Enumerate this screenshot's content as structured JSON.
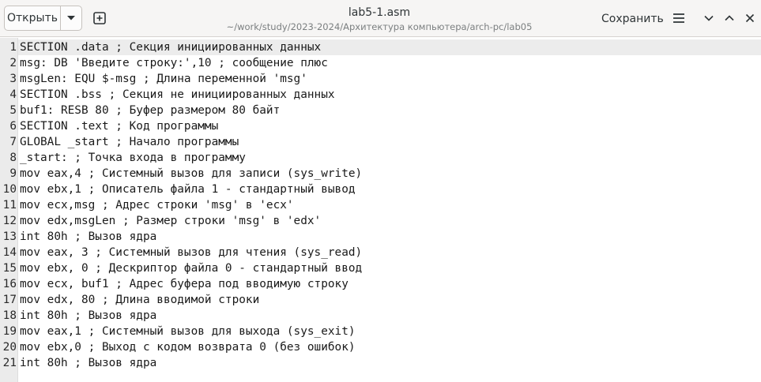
{
  "header": {
    "open_label": "Открыть",
    "title": "lab5-1.asm",
    "path": "~/work/study/2023-2024/Архитектура компьютера/arch-pc/lab05",
    "save_label": "Сохранить"
  },
  "icons": {
    "open_menu": "chevron-down-icon",
    "new_tab": "new-tab-icon",
    "main_menu": "hamburger-menu-icon",
    "minimize": "minimize-icon",
    "maximize": "maximize-icon",
    "close": "close-icon"
  },
  "editor": {
    "current_line": 1,
    "lines": [
      {
        "n": "1",
        "text": "SECTION .data ; Секция инициированных данных"
      },
      {
        "n": "2",
        "text": "msg: DB 'Введите строку:',10 ; сообщение плюс"
      },
      {
        "n": "3",
        "text": "msgLen: EQU $-msg ; Длина переменной 'msg'"
      },
      {
        "n": "4",
        "text": "SECTION .bss ; Секция не инициированных данных"
      },
      {
        "n": "5",
        "text": "buf1: RESB 80 ; Буфер размером 80 байт"
      },
      {
        "n": "6",
        "text": "SECTION .text ; Код программы"
      },
      {
        "n": "7",
        "text": "GLOBAL _start ; Начало программы"
      },
      {
        "n": "8",
        "text": "_start: ; Точка входа в программу"
      },
      {
        "n": "9",
        "text": "mov eax,4 ; Системный вызов для записи (sys_write)"
      },
      {
        "n": "10",
        "text": "mov ebx,1 ; Описатель файла 1 - стандартный вывод"
      },
      {
        "n": "11",
        "text": "mov ecx,msg ; Адрес строки 'msg' в 'ecx'"
      },
      {
        "n": "12",
        "text": "mov edx,msgLen ; Размер строки 'msg' в 'edx'"
      },
      {
        "n": "13",
        "text": "int 80h ; Вызов ядра"
      },
      {
        "n": "14",
        "text": "mov eax, 3 ; Системный вызов для чтения (sys_read)"
      },
      {
        "n": "15",
        "text": "mov ebx, 0 ; Дескриптор файла 0 - стандартный ввод"
      },
      {
        "n": "16",
        "text": "mov ecx, buf1 ; Адрес буфера под вводимую строку"
      },
      {
        "n": "17",
        "text": "mov edx, 80 ; Длина вводимой строки"
      },
      {
        "n": "18",
        "text": "int 80h ; Вызов ядра"
      },
      {
        "n": "19",
        "text": "mov eax,1 ; Системный вызов для выхода (sys_exit)"
      },
      {
        "n": "20",
        "text": "mov ebx,0 ; Выход с кодом возврата 0 (без ошибок)"
      },
      {
        "n": "21",
        "text": "int 80h ; Вызов ядра"
      }
    ]
  }
}
